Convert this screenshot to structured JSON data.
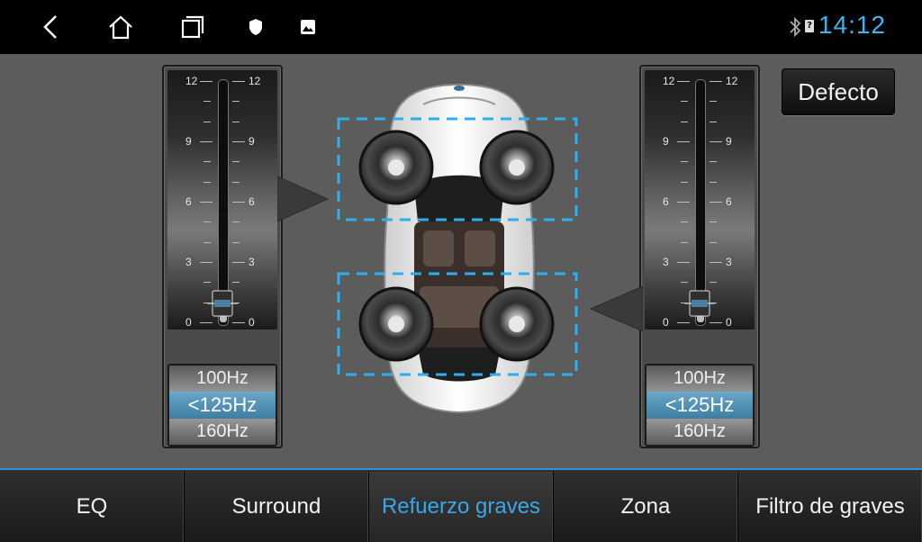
{
  "status": {
    "time": "14:12",
    "icons": [
      "back-icon",
      "home-icon",
      "recents-icon",
      "shield-icon",
      "image-icon",
      "bluetooth-icon",
      "battery-icon"
    ],
    "battery_glyph": "?"
  },
  "default_button": "Defecto",
  "left_slider": {
    "ticks": [
      "12",
      "9",
      "6",
      "3",
      "0"
    ],
    "level": 0.08,
    "frequencies": [
      "100Hz",
      "<125Hz",
      "160Hz"
    ]
  },
  "right_slider": {
    "ticks": [
      "12",
      "9",
      "6",
      "3",
      "0"
    ],
    "level": 0.08,
    "frequencies": [
      "100Hz",
      "<125Hz",
      "160Hz"
    ]
  },
  "tabs": [
    {
      "label": "EQ"
    },
    {
      "label": "Surround"
    },
    {
      "label": "Refuerzo graves"
    },
    {
      "label": "Zona"
    },
    {
      "label": "Filtro de graves"
    }
  ],
  "active_tab": 2,
  "colors": {
    "accent": "#3aa8e6",
    "selection": "#4a8cb2",
    "dashed": "#2ab0ec"
  }
}
